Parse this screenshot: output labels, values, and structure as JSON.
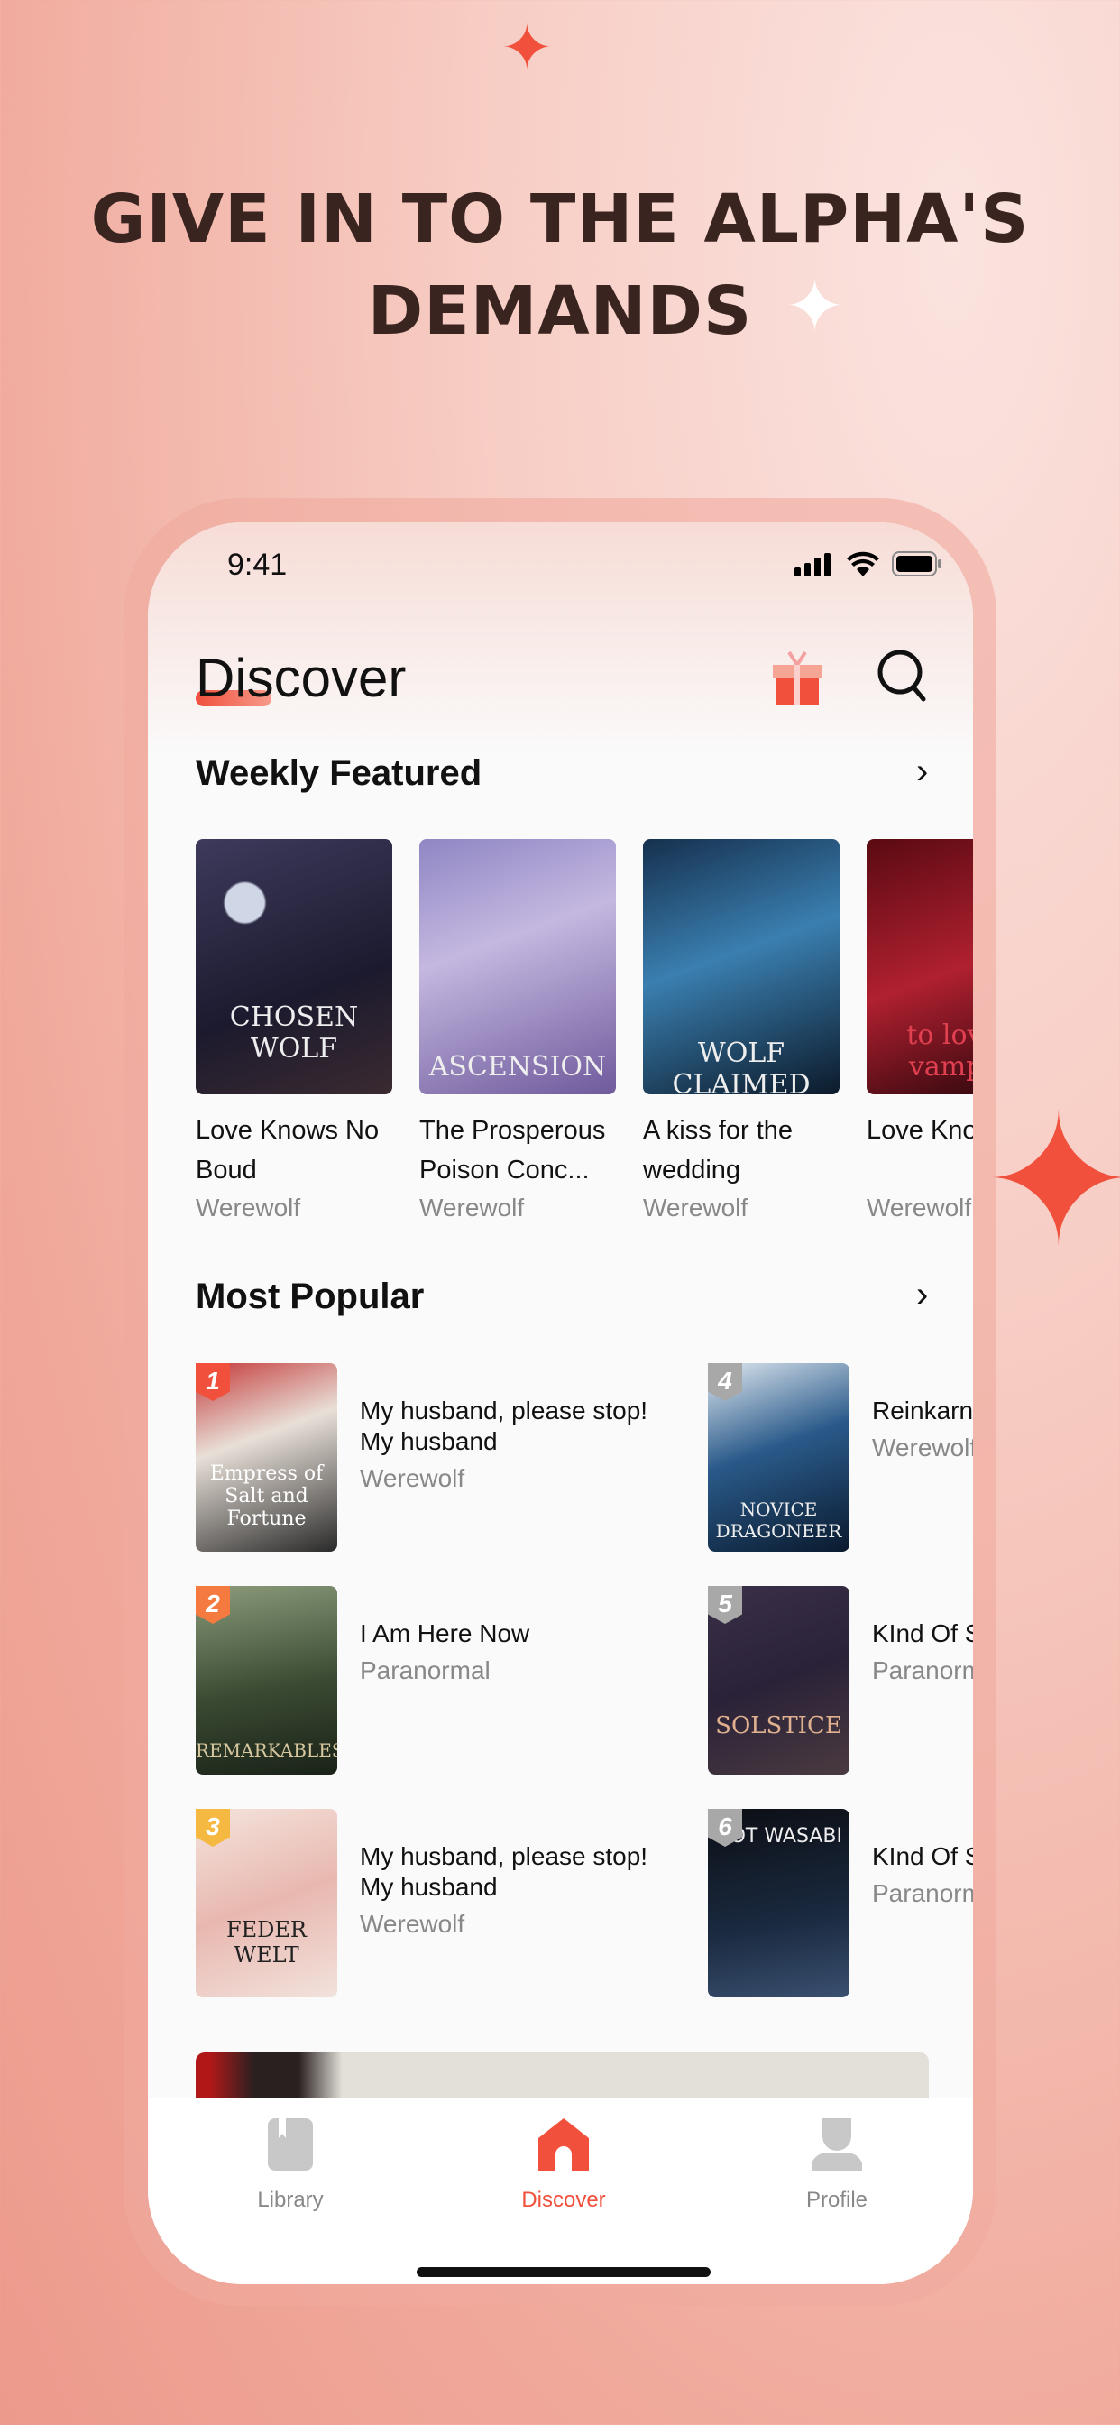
{
  "promo": {
    "headline_line1": "GIVE IN TO THE ALPHA'S",
    "headline_line2": "DEMANDS"
  },
  "status_bar": {
    "time": "9:41",
    "icons": [
      "signal-icon",
      "wifi-icon",
      "battery-icon"
    ]
  },
  "header": {
    "title": "Discover",
    "icons": [
      "gift-icon",
      "search-icon"
    ],
    "accent": "#f0503c"
  },
  "weekly": {
    "title": "Weekly Featured",
    "items": [
      {
        "title": "Love Knows No Boud",
        "genre": "Werewolf",
        "cover_text": "CHOSEN WOLF"
      },
      {
        "title": "The Prosperous Poison Conc...",
        "genre": "Werewolf",
        "cover_text": "ASCENSION"
      },
      {
        "title": "A kiss for the wedding",
        "genre": "Werewolf",
        "cover_text": "WOLF CLAIMED"
      },
      {
        "title": "Love Knows No Bound...",
        "genre": "Werewolf",
        "cover_text": "to love a vampire"
      }
    ]
  },
  "popular": {
    "title": "Most Popular",
    "items": [
      {
        "rank": "1",
        "title": "My husband, please stop! My husband",
        "genre": "Werewolf",
        "cover_text": "Empress of Salt and Fortune"
      },
      {
        "rank": "2",
        "title": "I Am Here Now",
        "genre": "Paranormal",
        "cover_text": "REMARKABLES"
      },
      {
        "rank": "3",
        "title": "My husband, please stop! My husband",
        "genre": "Werewolf",
        "cover_text": "FEDER WELT"
      },
      {
        "rank": "4",
        "title": "Reinkarnasi Peliharaan",
        "genre": "Werewolf",
        "cover_text": "NOVICE DRAGONEER"
      },
      {
        "rank": "5",
        "title": "KInd Of Sweet",
        "genre": "Paranormal",
        "cover_text": "SOLSTICE"
      },
      {
        "rank": "6",
        "title": "KInd Of Sweet",
        "genre": "Paranormal",
        "cover_text": "HOT WASABI"
      }
    ]
  },
  "tabbar": {
    "items": [
      {
        "label": "Library",
        "active": false
      },
      {
        "label": "Discover",
        "active": true
      },
      {
        "label": "Profile",
        "active": false
      }
    ],
    "active_color": "#f0503c",
    "inactive_color": "#888888"
  }
}
